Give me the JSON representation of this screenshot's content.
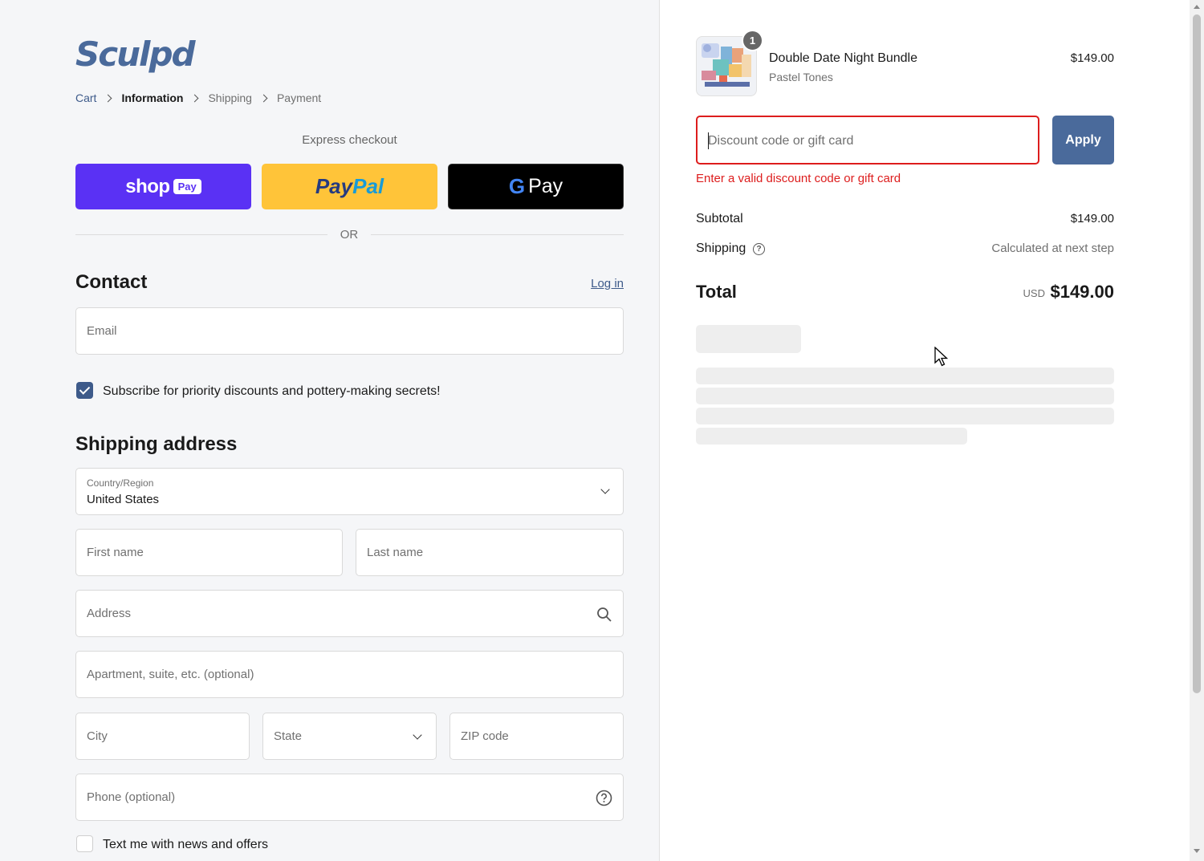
{
  "brand": {
    "logo_text": "Sculpd",
    "accent": "#4a6a9b"
  },
  "breadcrumb": [
    {
      "label": "Cart",
      "state": "link"
    },
    {
      "label": "Information",
      "state": "active"
    },
    {
      "label": "Shipping",
      "state": "upcoming"
    },
    {
      "label": "Payment",
      "state": "upcoming"
    }
  ],
  "express": {
    "label": "Express checkout",
    "shop_pay": {
      "word": "shop",
      "chip": "Pay"
    },
    "paypal": {
      "first": "Pay",
      "second": "Pal"
    },
    "google_pay": {
      "g": "G",
      "word": "Pay"
    },
    "divider": "OR"
  },
  "contact": {
    "title": "Contact",
    "login_link": "Log in",
    "email_placeholder": "Email",
    "subscribe_label": "Subscribe for priority discounts and pottery-making secrets!",
    "subscribe_checked": true
  },
  "shipping_address": {
    "title": "Shipping address",
    "country_label": "Country/Region",
    "country_value": "United States",
    "first_name": "First name",
    "last_name": "Last name",
    "address": "Address",
    "apartment": "Apartment, suite, etc. (optional)",
    "city": "City",
    "state": "State",
    "zip": "ZIP code",
    "phone": "Phone (optional)",
    "text_offers_label": "Text me with news and offers",
    "text_offers_checked": false
  },
  "order_summary": {
    "product": {
      "quantity": "1",
      "name": "Double Date Night Bundle",
      "variant": "Pastel Tones",
      "price": "$149.00"
    },
    "discount": {
      "placeholder": "Discount code or gift card",
      "apply_label": "Apply",
      "error": "Enter a valid discount code or gift card"
    },
    "subtotal_label": "Subtotal",
    "subtotal_value": "$149.00",
    "shipping_label": "Shipping",
    "shipping_value": "Calculated at next step",
    "total_label": "Total",
    "total_currency": "USD",
    "total_value": "$149.00"
  }
}
